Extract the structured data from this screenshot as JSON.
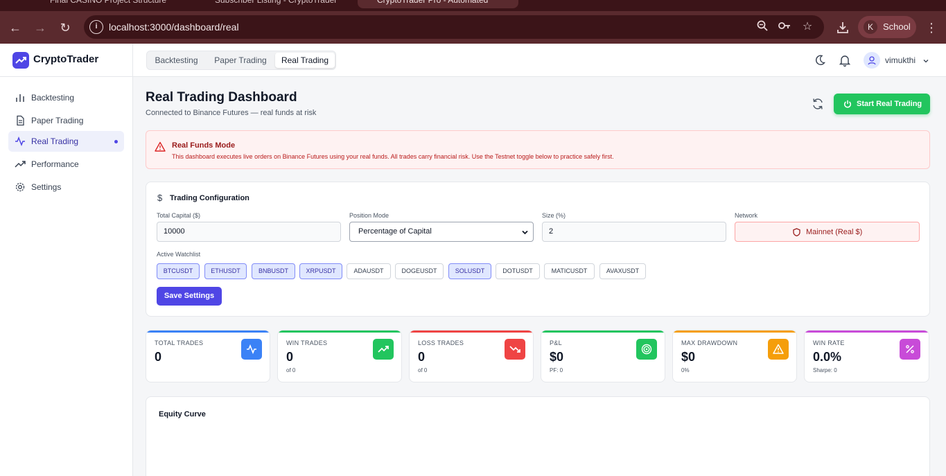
{
  "browser": {
    "tabs": [
      {
        "label": "Final CASINO Project Structure"
      },
      {
        "label": "Subscriber Listing - CryptoTrader"
      },
      {
        "label": "CryptoTrader Pro - Automated"
      }
    ],
    "url": "localhost:3000/dashboard/real",
    "profile_initial": "K",
    "profile_name": "School"
  },
  "app": {
    "brand": "CryptoTrader",
    "accent": "#4f46e5",
    "sidebar": [
      {
        "label": "Backtesting",
        "icon": "bar-chart-icon"
      },
      {
        "label": "Paper Trading",
        "icon": "document-icon"
      },
      {
        "label": "Real Trading",
        "icon": "activity-icon",
        "active": true
      },
      {
        "label": "Performance",
        "icon": "trending-up-icon"
      },
      {
        "label": "Settings",
        "icon": "gear-icon"
      }
    ],
    "mode_tabs": [
      {
        "label": "Backtesting"
      },
      {
        "label": "Paper Trading"
      },
      {
        "label": "Real Trading",
        "active": true
      }
    ],
    "user": "vimukthi"
  },
  "page": {
    "title": "Real Trading Dashboard",
    "subtitle": "Connected to Binance Futures — real funds at risk",
    "start_button": "Start Real Trading"
  },
  "alert": {
    "title": "Real Funds Mode",
    "text": "This dashboard executes live orders on Binance Futures using your real funds. All trades carry financial risk. Use the Testnet toggle below to practice safely first."
  },
  "config": {
    "title": "Trading Configuration",
    "capital_label": "Total Capital ($)",
    "capital_value": "10000",
    "mode_label": "Position Mode",
    "mode_value": "Percentage of Capital",
    "size_label": "Size (%)",
    "size_value": "2",
    "network_label": "Network",
    "network_value": "Mainnet (Real $)",
    "watchlist_label": "Active Watchlist",
    "watchlist": [
      {
        "symbol": "BTCUSDT",
        "selected": true
      },
      {
        "symbol": "ETHUSDT",
        "selected": true
      },
      {
        "symbol": "BNBUSDT",
        "selected": true
      },
      {
        "symbol": "XRPUSDT",
        "selected": true
      },
      {
        "symbol": "ADAUSDT",
        "selected": false
      },
      {
        "symbol": "DOGEUSDT",
        "selected": false
      },
      {
        "symbol": "SOLUSDT",
        "selected": true
      },
      {
        "symbol": "DOTUSDT",
        "selected": false
      },
      {
        "symbol": "MATICUSDT",
        "selected": false
      },
      {
        "symbol": "AVAXUSDT",
        "selected": false
      }
    ],
    "save_button": "Save Settings"
  },
  "stats": [
    {
      "label": "TOTAL TRADES",
      "value": "0",
      "sub": "",
      "color": "#3b82f6"
    },
    {
      "label": "WIN TRADES",
      "value": "0",
      "sub": "of 0",
      "color": "#22c55e"
    },
    {
      "label": "LOSS TRADES",
      "value": "0",
      "sub": "of 0",
      "color": "#ef4444"
    },
    {
      "label": "P&L",
      "value": "$0",
      "sub": "PF: 0",
      "color": "#22c55e"
    },
    {
      "label": "MAX DRAWDOWN",
      "value": "$0",
      "sub": "0%",
      "color": "#f59e0b"
    },
    {
      "label": "WIN RATE",
      "value": "0.0%",
      "sub": "Sharpe: 0",
      "color": "#c84bd8"
    }
  ],
  "equity": {
    "title": "Equity Curve"
  }
}
